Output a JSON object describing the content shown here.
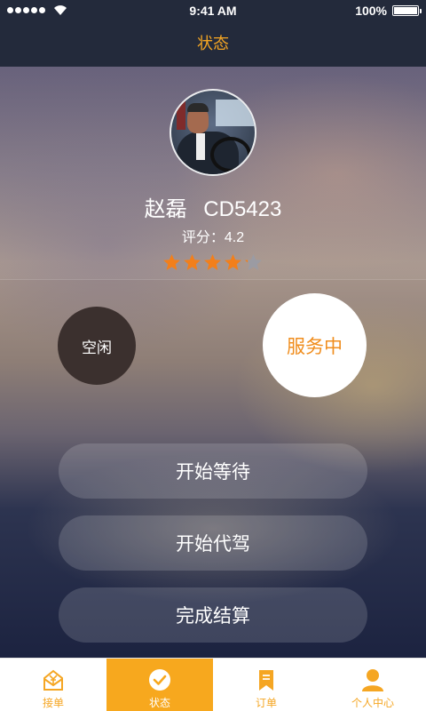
{
  "status_bar": {
    "time": "9:41 AM",
    "battery": "100%"
  },
  "header": {
    "title": "状态"
  },
  "profile": {
    "name": "赵磊",
    "plate": "CD5423",
    "rating_label": "评分：4.2",
    "rating_value": 4.2,
    "rating_max": 5
  },
  "status_toggle": {
    "idle_label": "空闲",
    "serving_label": "服务中",
    "current": "服务中"
  },
  "actions": [
    {
      "label": "开始等待"
    },
    {
      "label": "开始代驾"
    },
    {
      "label": "完成结算"
    }
  ],
  "tabbar": {
    "items": [
      {
        "label": "接单",
        "icon": "order-receive-icon"
      },
      {
        "label": "状态",
        "icon": "check-circle-icon",
        "active": true
      },
      {
        "label": "订单",
        "icon": "bookmark-list-icon"
      },
      {
        "label": "个人中心",
        "icon": "user-icon"
      }
    ]
  },
  "colors": {
    "accent": "#f7a81e",
    "serving_text": "#f08d1d",
    "header_bg": "#232a3b"
  }
}
